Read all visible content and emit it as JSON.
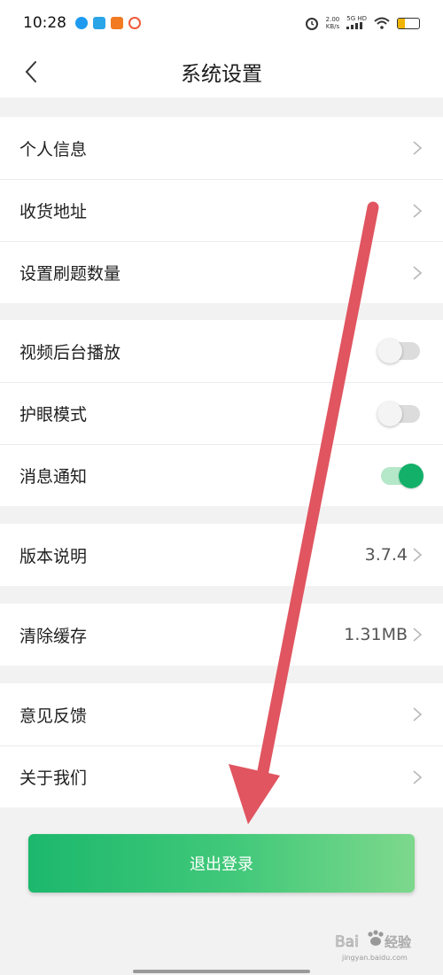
{
  "status_bar": {
    "time": "10:28",
    "speed_value": "2.00",
    "speed_unit": "KB/s",
    "network": "5G HD",
    "battery_level": 0.35
  },
  "nav": {
    "back_icon": "chevron-left-icon",
    "title": "系统设置"
  },
  "groups": {
    "account": [
      {
        "label": "个人信息"
      },
      {
        "label": "收货地址"
      },
      {
        "label": "设置刷题数量"
      }
    ],
    "preferences": [
      {
        "label": "视频后台播放",
        "toggle": false
      },
      {
        "label": "护眼模式",
        "toggle": false
      },
      {
        "label": "消息通知",
        "toggle": true
      }
    ],
    "version": {
      "label": "版本说明",
      "value": "3.7.4"
    },
    "cache": {
      "label": "清除缓存",
      "value": "1.31MB"
    },
    "about": [
      {
        "label": "意见反馈"
      },
      {
        "label": "关于我们"
      }
    ]
  },
  "logout": {
    "label": "退出登录"
  },
  "watermark": {
    "text": "Bai度经验",
    "sub": "jingyan.baidu.com"
  },
  "colors": {
    "accent_green": "#13b06a",
    "annotation_arrow": "#e05560",
    "background": "#f2f2f2"
  }
}
